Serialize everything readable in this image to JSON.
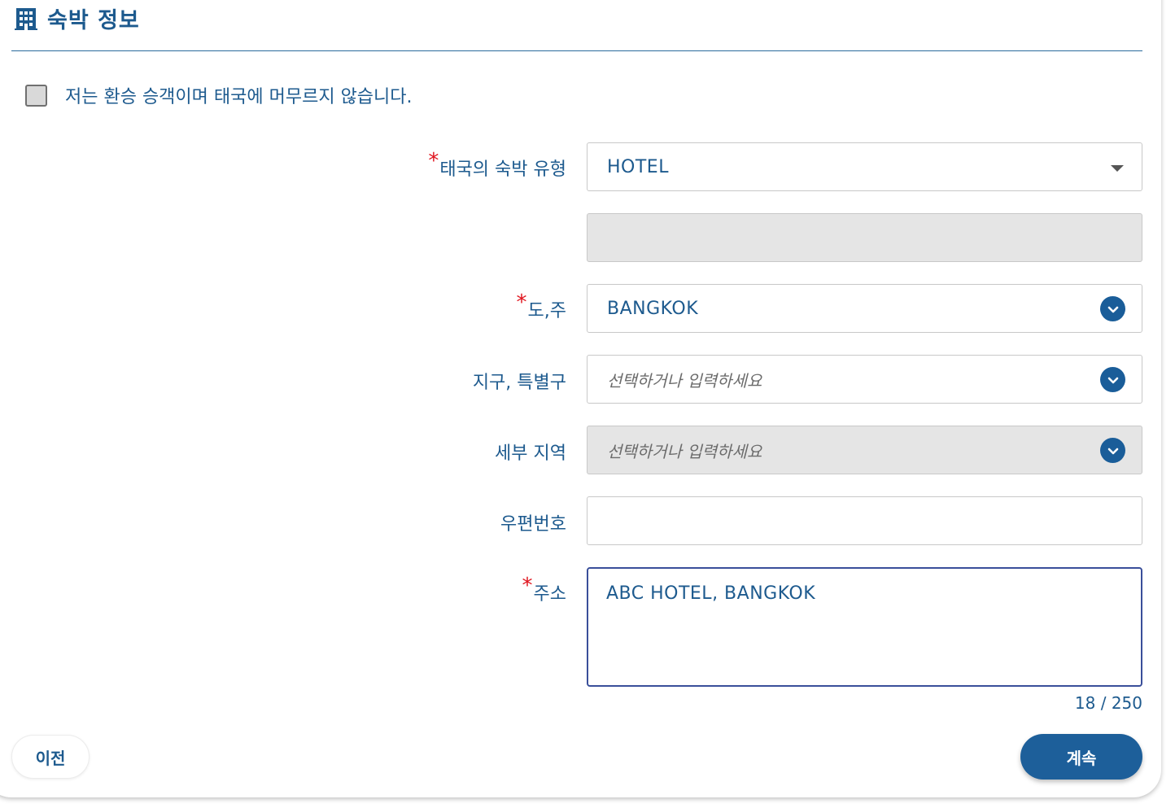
{
  "section": {
    "title": "숙박 정보",
    "icon": "building-icon"
  },
  "transit_checkbox": {
    "label": "저는 환승 승객이며 태국에 머무르지 않습니다.",
    "checked": false
  },
  "form": {
    "accommodation_type": {
      "required_mark": "*",
      "label": "태국의 숙박 유형",
      "value": "HOTEL"
    },
    "extra_field": {
      "value": ""
    },
    "province": {
      "required_mark": "*",
      "label": "도,주",
      "value": "BANGKOK"
    },
    "district": {
      "label": "지구, 특별구",
      "placeholder": "선택하거나 입력하세요"
    },
    "subdistrict": {
      "label": "세부 지역",
      "placeholder": "선택하거나 입력하세요"
    },
    "postal_code": {
      "label": "우편번호",
      "value": ""
    },
    "address": {
      "required_mark": "*",
      "label": "주소",
      "value": "ABC HOTEL, BANGKOK",
      "counter": "18 / 250"
    }
  },
  "buttons": {
    "previous": "이전",
    "continue": "계속"
  },
  "colors": {
    "primary": "#1d5a8e",
    "button": "#1d5f9a",
    "required": "#e0141e",
    "disabled_bg": "#e5e5e5"
  }
}
